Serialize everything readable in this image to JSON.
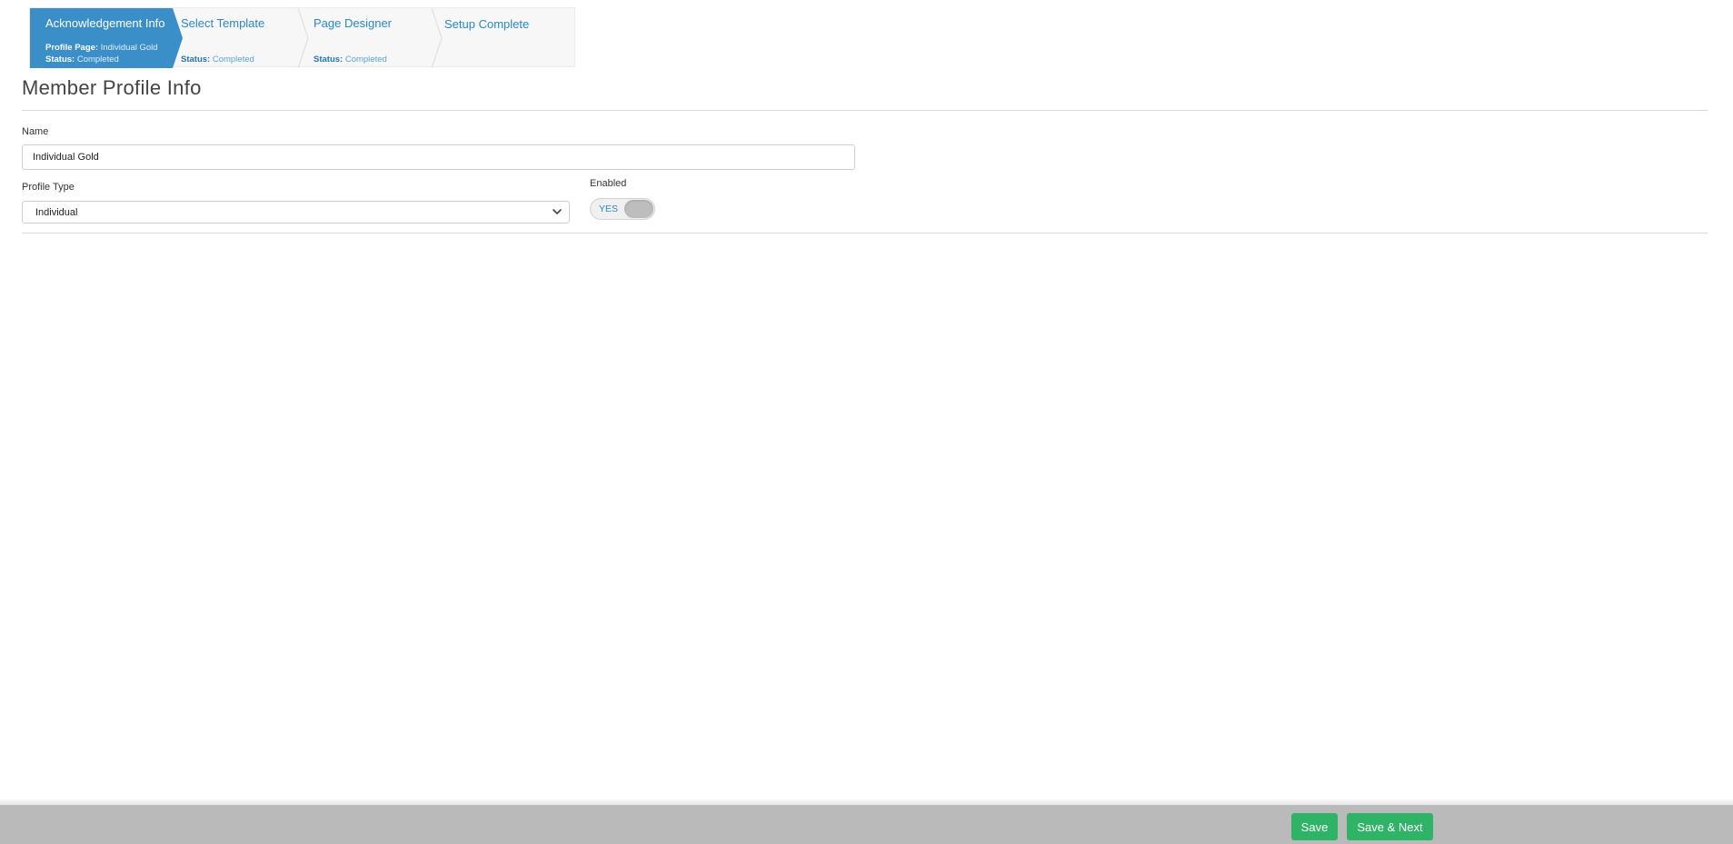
{
  "wizard": {
    "steps": [
      {
        "title": "Acknowledgement Info",
        "profile_label": "Profile Page:",
        "profile_value": "Individual Gold",
        "status_label": "Status:",
        "status_value": "Completed"
      },
      {
        "title": "Select Template",
        "status_label": "Status:",
        "status_value": "Completed"
      },
      {
        "title": "Page Designer",
        "status_label": "Status:",
        "status_value": "Completed"
      },
      {
        "title": "Setup Complete"
      }
    ]
  },
  "page_title": "Member Profile Info",
  "form": {
    "name_label": "Name",
    "name_value": "Individual Gold",
    "profile_type_label": "Profile Type",
    "profile_type_value": "Individual",
    "enabled_label": "Enabled",
    "enabled_toggle_text": "YES"
  },
  "footer": {
    "save_label": "Save",
    "save_next_label": "Save & Next"
  },
  "colors": {
    "wizard_active": "#3b8fc8",
    "link_blue": "#2b87c6",
    "button_green": "#2fb367",
    "footer_gray": "#bababa"
  }
}
